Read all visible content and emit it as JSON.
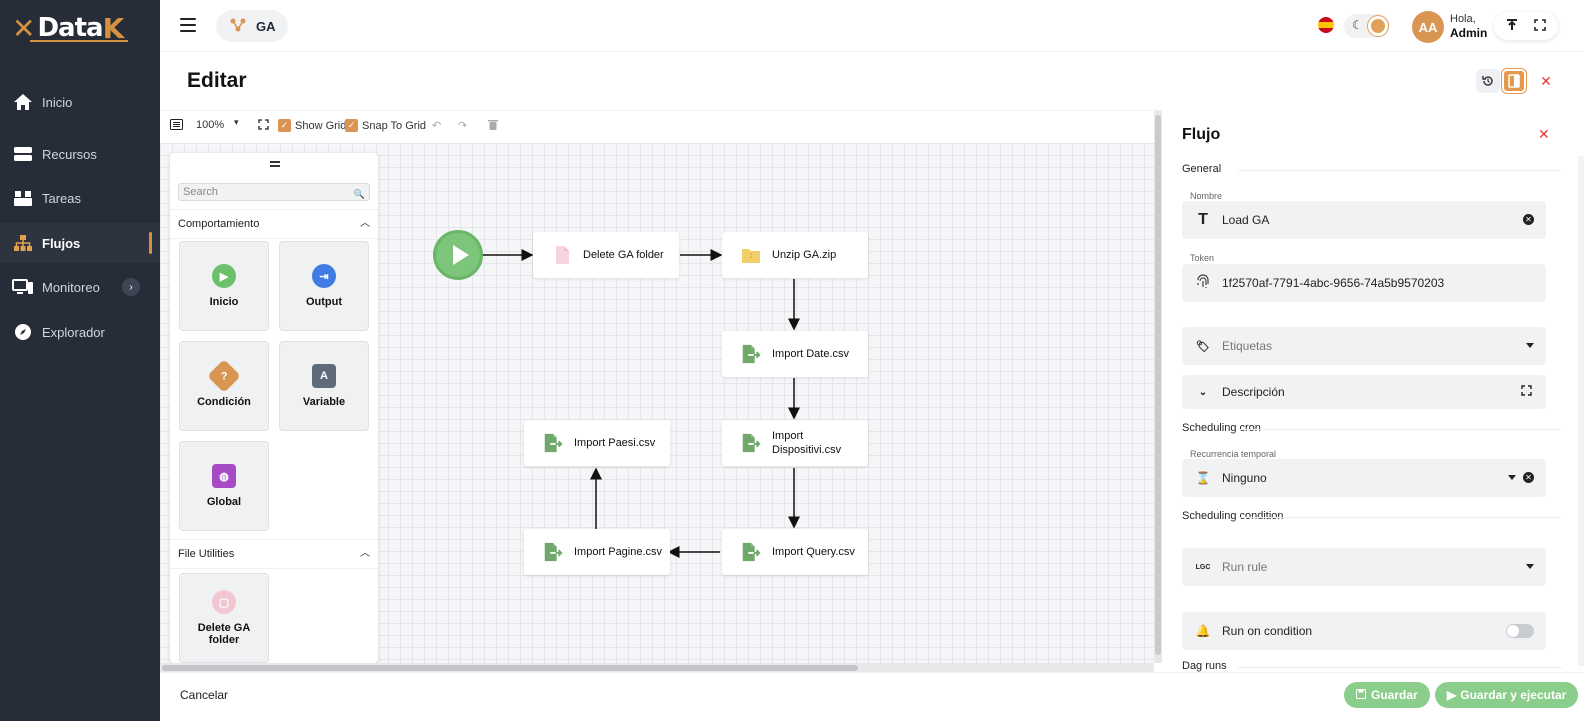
{
  "brand": {
    "logo_left": "Data",
    "logo_right": "K",
    "accent": "#d4913f"
  },
  "sidebar": {
    "items": [
      {
        "label": "Inicio",
        "icon": "home-icon"
      },
      {
        "label": "Recursos",
        "icon": "server-icon"
      },
      {
        "label": "Tareas",
        "icon": "boxes-icon"
      },
      {
        "label": "Flujos",
        "icon": "sitemap-icon",
        "active": true
      },
      {
        "label": "Monitoreo",
        "icon": "monitor-icon"
      },
      {
        "label": "Explorador",
        "icon": "compass-icon"
      }
    ]
  },
  "header": {
    "app_name": "GA",
    "greeting": "Hola,",
    "user": "Admin",
    "avatar_initials": "AA",
    "language_flag": "es"
  },
  "page": {
    "title": "Editar"
  },
  "toolbar": {
    "zoom": "100%",
    "show_grid": "Show Grid",
    "snap_to_grid": "Snap To Grid"
  },
  "palette": {
    "search_placeholder": "Search",
    "sections": [
      {
        "title": "Comportamiento",
        "items": [
          {
            "label": "Inicio",
            "color": "#6cc06a"
          },
          {
            "label": "Output",
            "color": "#3f7be0"
          },
          {
            "label": "Condición",
            "color": "#d99552"
          },
          {
            "label": "Variable",
            "color": "#5e6b78"
          },
          {
            "label": "Global",
            "color": "#a74bc4"
          }
        ]
      },
      {
        "title": "File Utilities",
        "items": [
          {
            "label": "Delete GA folder",
            "color": "#f2c7d2"
          }
        ]
      }
    ]
  },
  "flow": {
    "nodes": [
      {
        "id": "delete",
        "label": "Delete GA folder",
        "icon": "file-icon"
      },
      {
        "id": "unzip",
        "label": "Unzip GA.zip",
        "icon": "zip-folder-icon"
      },
      {
        "id": "date",
        "label": "Import Date.csv",
        "icon": "file-import-icon"
      },
      {
        "id": "dispositivi",
        "label": "Import Dispositivi.csv",
        "icon": "file-import-icon"
      },
      {
        "id": "query",
        "label": "Import Query.csv",
        "icon": "file-import-icon"
      },
      {
        "id": "pagine",
        "label": "Import Pagine.csv",
        "icon": "file-import-icon"
      },
      {
        "id": "paesi",
        "label": "Import Paesi.csv",
        "icon": "file-import-icon"
      }
    ]
  },
  "panel": {
    "title": "Flujo",
    "general": "General",
    "name_label": "Nombre",
    "name_value": "Load GA",
    "token_label": "Token",
    "token_value": "1f2570af-7791-4abc-9656-74a5b9570203",
    "tags_placeholder": "Etiquetas",
    "description": "Descripción",
    "scheduling_cron": "Scheduling cron",
    "recurrence_label": "Recurrencia temporal",
    "recurrence_value": "Ninguno",
    "scheduling_condition": "Scheduling condition",
    "run_rule_placeholder": "Run rule",
    "run_on_condition": "Run on condition",
    "dag_runs": "Dag runs"
  },
  "footer": {
    "cancel": "Cancelar",
    "save": "Guardar",
    "save_run": "Guardar y ejecutar"
  }
}
